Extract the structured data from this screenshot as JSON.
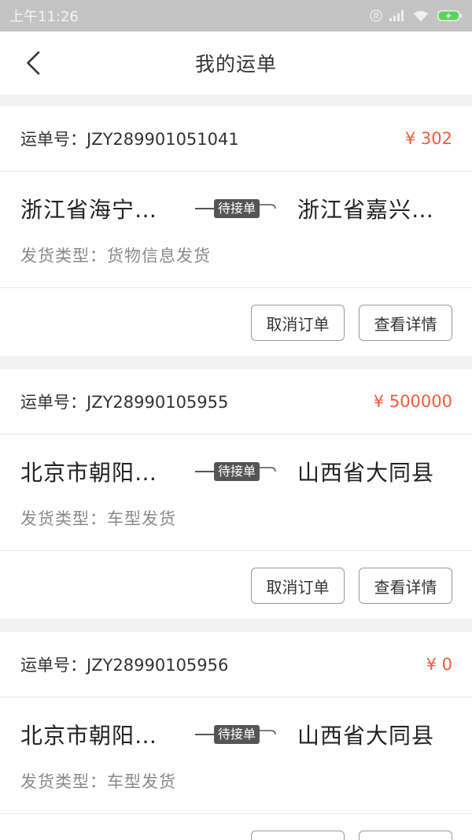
{
  "status_bar": {
    "time": "上午11:26",
    "icons": [
      "registered-icon",
      "signal-icon",
      "wifi-icon",
      "battery-charging-icon"
    ]
  },
  "header": {
    "title": "我的运单",
    "back_icon": "chevron-left-icon"
  },
  "labels": {
    "order_no_prefix": "运单号：",
    "ship_type_prefix": "发货类型：",
    "cancel_button": "取消订单",
    "detail_button": "查看详情"
  },
  "orders": [
    {
      "order_no": "JZY289901051041",
      "price": "¥ 302",
      "origin": "浙江省海宁…",
      "status": "待接单",
      "destination": "浙江省嘉兴…",
      "ship_type": "货物信息发货"
    },
    {
      "order_no": "JZY28990105955",
      "price": "¥ 500000",
      "origin": "北京市朝阳…",
      "status": "待接单",
      "destination": "山西省大同县",
      "ship_type": "车型发货"
    },
    {
      "order_no": "JZY28990105956",
      "price": "¥ 0",
      "origin": "北京市朝阳…",
      "status": "待接单",
      "destination": "山西省大同县",
      "ship_type": "车型发货"
    }
  ],
  "colors": {
    "price": "#f55a3c",
    "badge": "#555555",
    "text": "#333333",
    "muted": "#8a8a8a",
    "divider": "#e6e6e6",
    "page": "#f2f2f2",
    "statusbar": "#c3c3c3",
    "battery": "#5bd35b"
  }
}
